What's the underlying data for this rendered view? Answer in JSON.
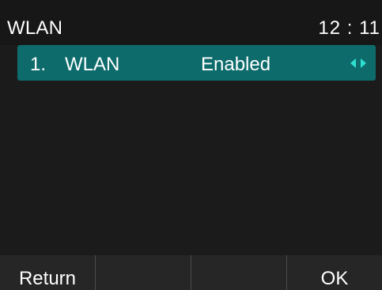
{
  "header": {
    "title": "WLAN",
    "clock": "12 : 11"
  },
  "list": {
    "items": [
      {
        "index": "1.",
        "label": "WLAN",
        "value": "Enabled",
        "icon_left": "arrow-left-icon",
        "icon_right": "arrow-right-icon"
      }
    ]
  },
  "softkeys": [
    {
      "label": "Return"
    },
    {
      "label": ""
    },
    {
      "label": ""
    },
    {
      "label": "OK"
    }
  ],
  "colors": {
    "background": "#1b1b1b",
    "selected_row": "#0d6b6b",
    "arrow_accent": "#2fe0d2",
    "softkey_bar": "#262626"
  }
}
